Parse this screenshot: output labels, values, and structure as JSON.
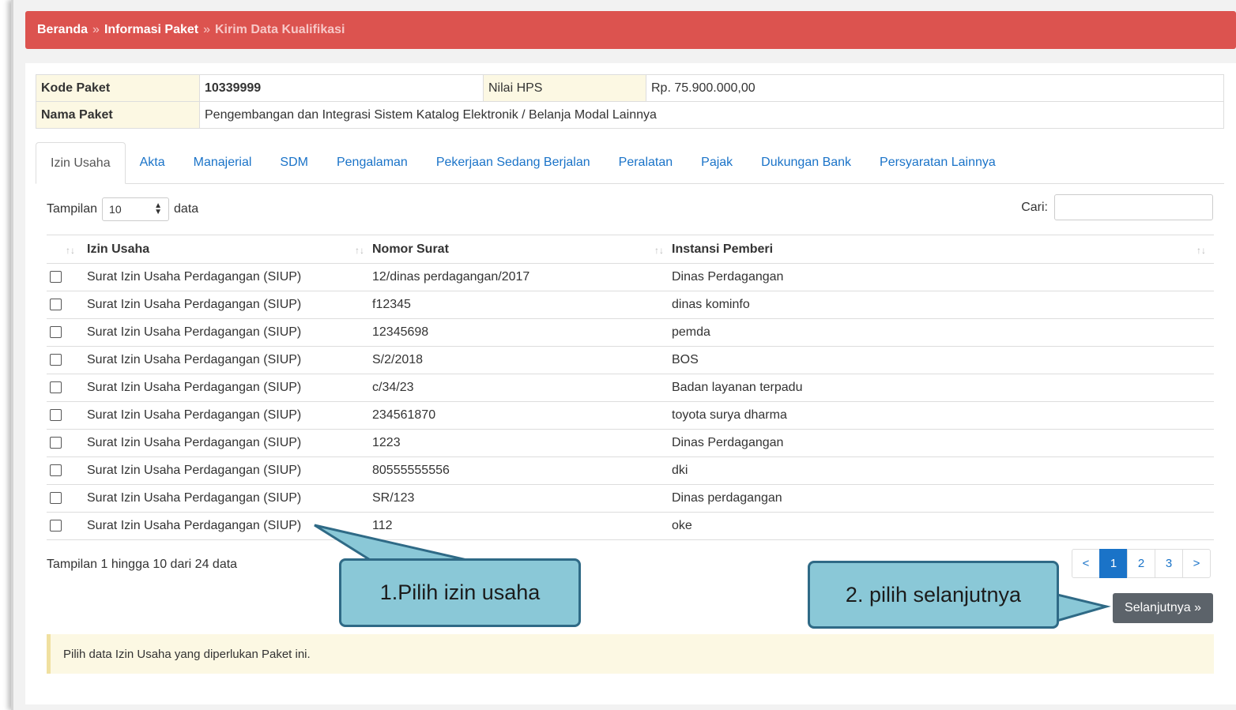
{
  "breadcrumb": {
    "home": "Beranda",
    "separator": "»",
    "info": "Informasi Paket",
    "current": "Kirim Data Kualifikasi"
  },
  "paket": {
    "kode_label": "Kode Paket",
    "kode_value": "10339999",
    "hps_label": "Nilai HPS",
    "hps_value": "Rp. 75.900.000,00",
    "nama_label": "Nama Paket",
    "nama_value": "Pengembangan dan Integrasi Sistem Katalog Elektronik / Belanja Modal Lainnya"
  },
  "tabs": [
    "Izin Usaha",
    "Akta",
    "Manajerial",
    "SDM",
    "Pengalaman",
    "Pekerjaan Sedang Berjalan",
    "Peralatan",
    "Pajak",
    "Dukungan Bank",
    "Persyaratan Lainnya"
  ],
  "active_tab": "Izin Usaha",
  "table_controls": {
    "length_prefix": "Tampilan",
    "length_value": "10",
    "length_suffix": "data",
    "search_label": "Cari:",
    "search_value": ""
  },
  "table": {
    "headers": [
      "Izin Usaha",
      "Nomor Surat",
      "Instansi Pemberi"
    ],
    "rows": [
      {
        "izin": "Surat Izin Usaha Perdagangan (SIUP)",
        "nomor": "12/dinas perdagangan/2017",
        "instansi": "Dinas Perdagangan"
      },
      {
        "izin": "Surat Izin Usaha Perdagangan (SIUP)",
        "nomor": "f12345",
        "instansi": "dinas kominfo"
      },
      {
        "izin": "Surat Izin Usaha Perdagangan (SIUP)",
        "nomor": "12345698",
        "instansi": "pemda"
      },
      {
        "izin": "Surat Izin Usaha Perdagangan (SIUP)",
        "nomor": "S/2/2018",
        "instansi": "BOS"
      },
      {
        "izin": "Surat Izin Usaha Perdagangan (SIUP)",
        "nomor": "c/34/23",
        "instansi": "Badan layanan terpadu"
      },
      {
        "izin": "Surat Izin Usaha Perdagangan (SIUP)",
        "nomor": "234561870",
        "instansi": "toyota surya dharma"
      },
      {
        "izin": "Surat Izin Usaha Perdagangan (SIUP)",
        "nomor": "1223",
        "instansi": "Dinas Perdagangan"
      },
      {
        "izin": "Surat Izin Usaha Perdagangan (SIUP)",
        "nomor": "80555555556",
        "instansi": "dki"
      },
      {
        "izin": "Surat Izin Usaha Perdagangan (SIUP)",
        "nomor": "SR/123",
        "instansi": "Dinas perdagangan"
      },
      {
        "izin": "Surat Izin Usaha Perdagangan (SIUP)",
        "nomor": "112",
        "instansi": "oke"
      }
    ]
  },
  "table_info": "Tampilan 1 hingga 10 dari 24 data",
  "pagination": {
    "prev": "<",
    "pages": [
      "1",
      "2",
      "3"
    ],
    "active_page": "1",
    "next": ">"
  },
  "next_button": "Selanjutnya »",
  "alert_text": "Pilih data Izin Usaha yang diperlukan Paket ini.",
  "callouts": {
    "first": "1.Pilih izin usaha",
    "second": "2. pilih selanjutnya"
  },
  "colors": {
    "breadcrumb_bg": "#dc534f",
    "link": "#1a73c8",
    "highlight_bg": "#fcf8e3",
    "callout_fill": "#8ac8d7",
    "callout_border": "#2f6a86",
    "button_bg": "#5c636a"
  }
}
